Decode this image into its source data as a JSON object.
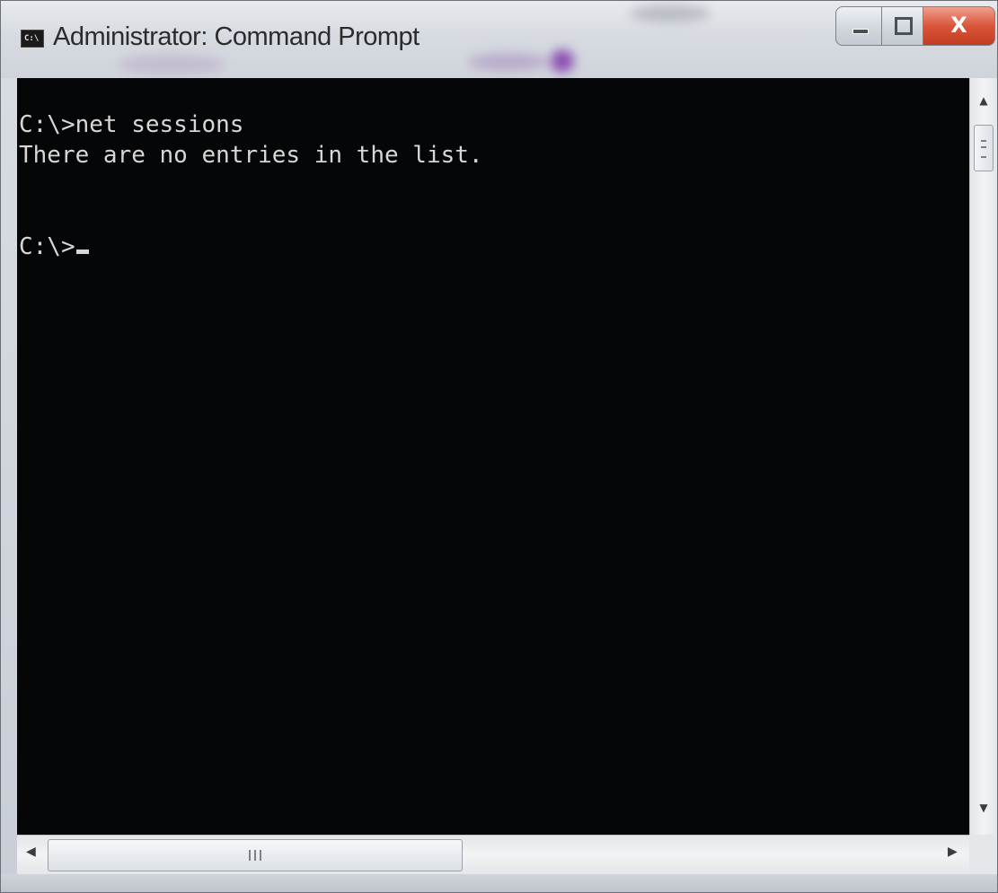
{
  "window": {
    "title": "Administrator: Command Prompt",
    "icon": "command-prompt-icon",
    "icon_glyph": "C:\\",
    "close_glyph": "X"
  },
  "console": {
    "lines": [
      "C:\\>net sessions",
      "There are no entries in the list.",
      "",
      "C:\\>"
    ],
    "foreground": "#d7d7d7",
    "background": "#050607"
  },
  "scrollbars": {
    "up_arrow": "▲",
    "down_arrow": "▼",
    "left_arrow": "◀",
    "right_arrow": "▶"
  },
  "colors": {
    "close_button": "#d9553a",
    "titlebar": "#d7dbe1"
  }
}
